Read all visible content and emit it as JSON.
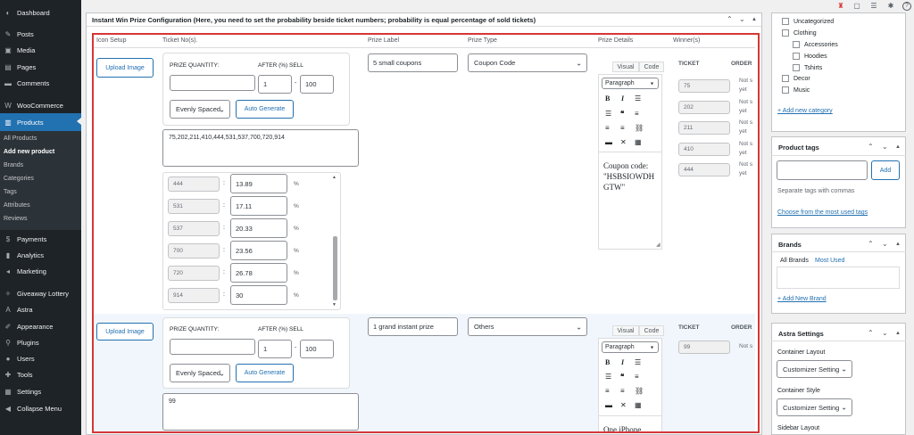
{
  "sidebar": {
    "items": [
      {
        "label": "Dashboard",
        "icon": "dashboard-icon",
        "glyph": "◐"
      },
      {
        "label": "Posts",
        "icon": "pin-icon",
        "glyph": "✎"
      },
      {
        "label": "Media",
        "icon": "media-icon",
        "glyph": "▣"
      },
      {
        "label": "Pages",
        "icon": "pages-icon",
        "glyph": "▤"
      },
      {
        "label": "Comments",
        "icon": "comment-icon",
        "glyph": "▬"
      },
      {
        "label": "WooCommerce",
        "icon": "woo-icon",
        "glyph": "W"
      },
      {
        "label": "Products",
        "icon": "products-icon",
        "glyph": "▥"
      },
      {
        "label": "Payments",
        "icon": "payments-icon",
        "glyph": "$"
      },
      {
        "label": "Analytics",
        "icon": "analytics-icon",
        "glyph": "▮"
      },
      {
        "label": "Marketing",
        "icon": "marketing-icon",
        "glyph": "◂"
      },
      {
        "label": "Giveaway Lottery",
        "icon": "lottery-icon",
        "glyph": "✧"
      },
      {
        "label": "Astra",
        "icon": "astra-icon",
        "glyph": "A"
      },
      {
        "label": "Appearance",
        "icon": "appearance-icon",
        "glyph": "✐"
      },
      {
        "label": "Plugins",
        "icon": "plugins-icon",
        "glyph": "⚲"
      },
      {
        "label": "Users",
        "icon": "users-icon",
        "glyph": "●"
      },
      {
        "label": "Tools",
        "icon": "tools-icon",
        "glyph": "✚"
      },
      {
        "label": "Settings",
        "icon": "settings-icon",
        "glyph": "▦"
      },
      {
        "label": "Collapse Menu",
        "icon": "collapse-icon",
        "glyph": "◀"
      }
    ],
    "submenu": [
      "All Products",
      "Add new product",
      "Brands",
      "Categories",
      "Tags",
      "Attributes",
      "Reviews"
    ]
  },
  "topbar": {
    "icons": [
      "♜",
      "▢",
      "☰",
      "✱",
      "?"
    ]
  },
  "panel": {
    "title": "Instant Win Prize Configuration (Here, you need to set the probability beside ticket numbers; probability is equal percentage of sold tickets)",
    "columns": [
      "Icon Setup",
      "Ticket No(s).",
      "Prize Label",
      "Prize Type",
      "Prize Details",
      "Winner(s)"
    ]
  },
  "row1": {
    "upload_label": "Upload Image",
    "prize_quantity_label": "PRIZE QUANTITY:",
    "after_sell_label": "AFTER (%) SELL",
    "prize_quantity": "",
    "after_from": "1",
    "after_dash": "-",
    "after_to": "100",
    "spacing": "Evenly Spaced",
    "auto_generate": "Auto Generate",
    "tickets": "75,202,211,410,444,531,537,700,720,914",
    "probabilities": [
      {
        "ticket": "444",
        "value": "13.89"
      },
      {
        "ticket": "531",
        "value": "17.11"
      },
      {
        "ticket": "537",
        "value": "20.33"
      },
      {
        "ticket": "700",
        "value": "23.56"
      },
      {
        "ticket": "720",
        "value": "26.78"
      },
      {
        "ticket": "914",
        "value": "30"
      }
    ],
    "colon": ":",
    "pct": "%",
    "prize_label": "5 small coupons",
    "prize_type": "Coupon Code",
    "editor_tabs": [
      "Visual",
      "Code"
    ],
    "format": "Paragraph",
    "details": "Coupon code: \"HSBSIOWDHGTW\"",
    "winner_cols": [
      "TICKET",
      "ORDER"
    ],
    "winners": [
      {
        "ticket": "75",
        "order": "Not s yet"
      },
      {
        "ticket": "202",
        "order": "Not s yet"
      },
      {
        "ticket": "211",
        "order": "Not s yet"
      },
      {
        "ticket": "410",
        "order": "Not s yet"
      },
      {
        "ticket": "444",
        "order": "Not s yet"
      }
    ]
  },
  "row2": {
    "upload_label": "Upload Image",
    "prize_quantity_label": "PRIZE QUANTITY:",
    "after_sell_label": "AFTER (%) SELL",
    "prize_quantity": "",
    "after_from": "1",
    "after_dash": "-",
    "after_to": "100",
    "spacing": "Evenly Spaced",
    "auto_generate": "Auto Generate",
    "tickets": "99",
    "prize_label": "1 grand instant prize",
    "prize_type": "Others",
    "editor_tabs": [
      "Visual",
      "Code"
    ],
    "format": "Paragraph",
    "details": "One iPhone",
    "winner_cols": [
      "TICKET",
      "ORDER"
    ],
    "winners": [
      {
        "ticket": "99",
        "order": "Not s"
      }
    ]
  },
  "right": {
    "categories": [
      "Uncategorized",
      "Clothing",
      "Accessories",
      "Hoodies",
      "Tshirts",
      "Decor",
      "Music"
    ],
    "add_category": "+ Add new category",
    "tags_title": "Product tags",
    "tags_add": "Add",
    "tags_hint": "Separate tags with commas",
    "tags_link": "Choose from the most used tags",
    "brands_title": "Brands",
    "brands_tabs": [
      "All Brands",
      "Most Used"
    ],
    "brands_add": "+ Add New Brand",
    "astra_title": "Astra Settings",
    "container_layout_label": "Container Layout",
    "container_layout_value": "Customizer Setting",
    "container_style_label": "Container Style",
    "container_style_value": "Customizer Setting",
    "sidebar_layout_label": "Sidebar Layout"
  }
}
